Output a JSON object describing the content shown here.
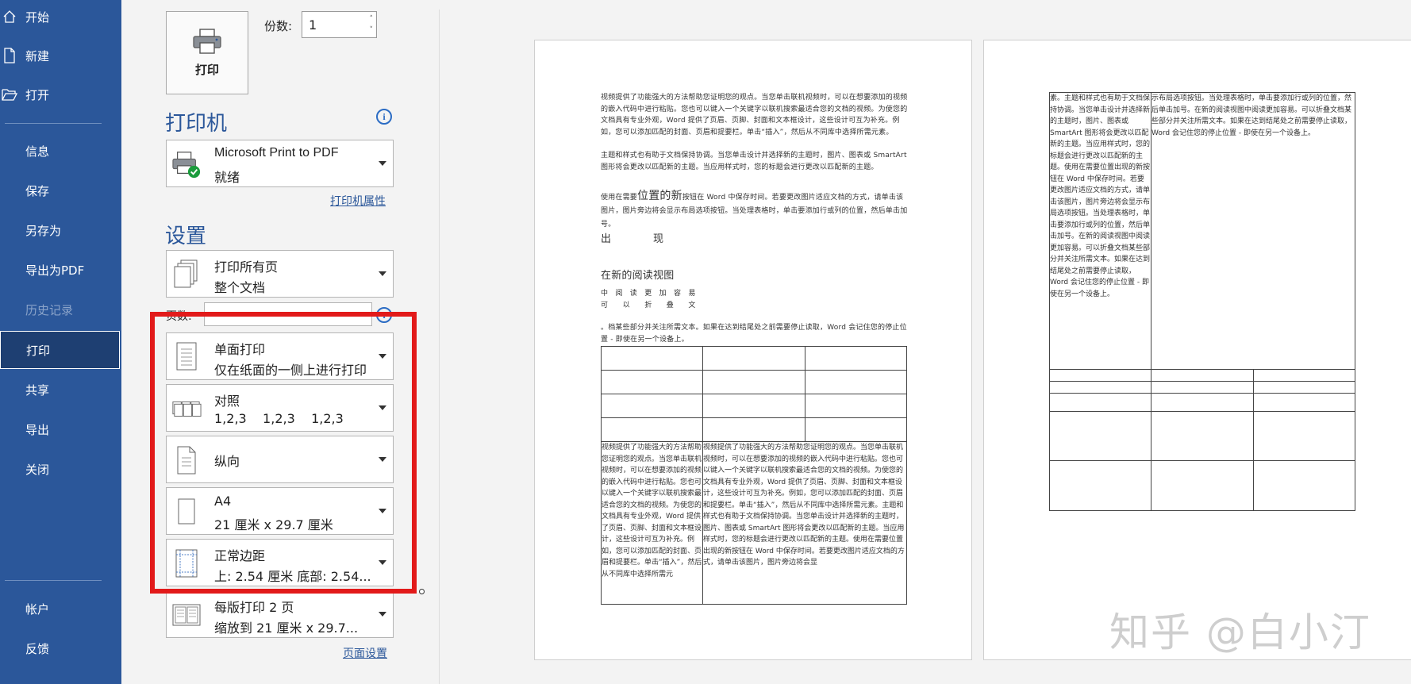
{
  "sidebar": {
    "items": [
      {
        "label": "开始",
        "icon": "home-icon"
      },
      {
        "label": "新建",
        "icon": "new-document-icon"
      },
      {
        "label": "打开",
        "icon": "open-folder-icon"
      },
      {
        "label": "信息"
      },
      {
        "label": "保存"
      },
      {
        "label": "另存为"
      },
      {
        "label": "导出为PDF"
      },
      {
        "label": "历史记录",
        "disabled": true
      },
      {
        "label": "打印",
        "active": true
      },
      {
        "label": "共享"
      },
      {
        "label": "导出"
      },
      {
        "label": "关闭"
      },
      {
        "label": "帐户"
      },
      {
        "label": "反馈"
      }
    ]
  },
  "print": {
    "button_label": "打印",
    "copies_label": "份数:",
    "copies_value": "1"
  },
  "printer": {
    "section_title": "打印机",
    "name": "Microsoft Print to PDF",
    "status": "就绪",
    "properties_link": "打印机属性"
  },
  "settings": {
    "section_title": "设置",
    "pages_label": "页数:",
    "pages_value": "",
    "options": [
      {
        "line1": "打印所有页",
        "line2": "整个文档",
        "icon": "pages-icon"
      },
      {
        "line1": "单面打印",
        "line2": "仅在纸面的一侧上进行打印",
        "icon": "one-sided-icon"
      },
      {
        "line1": "对照",
        "line2": "1,2,3    1,2,3    1,2,3",
        "icon": "collate-icon"
      },
      {
        "line1": "纵向",
        "line2": "",
        "icon": "portrait-icon"
      },
      {
        "line1": "A4",
        "line2": "21 厘米 x 29.7 厘米",
        "icon": "paper-size-icon"
      },
      {
        "line1": "正常边距",
        "line2": "上: 2.54 厘米 底部: 2.54...",
        "icon": "margins-icon"
      },
      {
        "line1": "每版打印 2 页",
        "line2": "缩放到 21 厘米 x 29.7...",
        "icon": "pages-per-sheet-icon"
      }
    ],
    "page_setup_link": "页面设置"
  },
  "preview": {
    "page1": {
      "para1": "视频提供了功能强大的方法帮助您证明您的观点。当您单击联机视频时，可以在想要添加的视频的嵌入代码中进行粘贴。您也可以键入一个关键字以联机搜索最适合您的文档的视频。为使您的文档具有专业外观，Word 提供了页眉、页脚、封面和文本框设计，这些设计可互为补充。例如，您可以添加匹配的封面、页眉和提要栏。单击“插入”，然后从不同库中选择所需元素。",
      "para2": "主题和样式也有助于文档保持协调。当您单击设计并选择新的主题时，图片、图表或 SmartArt 图形将会更改以匹配新的主题。当应用样式时，您的标题会进行更改以匹配新的主题。",
      "para3a": "使用在需要",
      "para3b": "位置的新",
      "para3c": "按钮在 Word 中保存时间。若要更改图片适应文档的方式，请单击该图片，图片旁边将会显示布局选项按钮。当处理表格时，单击要添加行或列的位置，然后单击加号。",
      "heading1": "出　　　　现",
      "heading2": "在新的阅读视图",
      "line_a": "中　阅　读　更　加　容　易",
      "line_b": "可　　以　　折　　叠　　文",
      "para4": "。档某些部分并关注所需文本。如果在达到结尾处之前需要停止读取，Word 会记住您的停止位置 - 即使在另一个设备上。",
      "cell_left": "视频提供了功能强大的方法帮助您证明您的观点。当您单击联机视频时，可以在想要添加的视频的嵌入代码中进行粘贴。您也可以键入一个关键字以联机搜索最适合您的文档的视频。为使您的文档具有专业外观，Word 提供了页眉、页脚、封面和文本框设计，这些设计可互为补充。例如，您可以添加匹配的封面、页眉和提要栏。单击“插入”，然后从不同库中选择所需元",
      "cell_right": "视频提供了功能强大的方法帮助您证明您的观点。当您单击联机视频时，可以在想要添加的视频的嵌入代码中进行粘贴。您也可以键入一个关键字以联机搜索最适合您的文档的视频。为使您的文档具有专业外观，Word 提供了页眉、页脚、封面和文本框设计，这些设计可互为补充。例如，您可以添加匹配的封面、页眉和提要栏。单击“插入”，然后从不同库中选择所需元素。主题和样式也有助于文档保持协调。当您单击设计并选择新的主题时，图片、图表或 SmartArt 图形将会更改以匹配新的主题。当应用样式时，您的标题会进行更改以匹配新的主题。使用在需要位置出现的新按钮在 Word 中保存时间。若要更改图片适应文档的方式，请单击该图片，图片旁边将会显"
    },
    "page2": {
      "cell_left": "素。主题和样式也有助于文档保持协调。当您单击设计并选择新的主题时，图片、图表或 SmartArt 图形将会更改以匹配新的主题。当应用样式时，您的标题会进行更改以匹配新的主题。使用在需要位置出现的新按钮在 Word 中保存时间。若要更改图片适应文档的方式，请单击该图片，图片旁边将会显示布局选项按钮。当处理表格时，单击要添加行或列的位置，然后单击加号。在新的阅读视图中阅读更加容易。可以折叠文档某些部分并关注所需文本。如果在达到结尾处之前需要停止读取，Word 会记住您的停止位置 - 即使在另一个设备上。",
      "cell_right": "示布局选项按钮。当处理表格时，单击要添加行或列的位置，然后单击加号。在新的阅读视图中阅读更加容易。可以折叠文档某些部分并关注所需文本。如果在达到结尾处之前需要停止读取，Word 会记住您的停止位置 - 即使在另一个设备上。"
    },
    "watermark": "知乎 @白小汀"
  },
  "colors": {
    "sidebar_bg": "#2b579a",
    "accent": "#2b579a",
    "highlight": "#e21a1a"
  }
}
